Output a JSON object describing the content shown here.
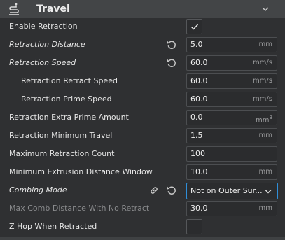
{
  "section": {
    "title": "Travel",
    "icon": "travel-icon",
    "collapse_icon": "chevron-down-icon"
  },
  "settings": [
    {
      "label": "Enable Retraction",
      "type": "checkbox",
      "checked": true
    },
    {
      "label": "Retraction Distance",
      "type": "number",
      "value": "5.0",
      "unit": "mm",
      "modified": true
    },
    {
      "label": "Retraction Speed",
      "type": "number",
      "value": "60.0",
      "unit": "mm/s",
      "modified": true
    },
    {
      "label": "Retraction Retract Speed",
      "type": "number",
      "value": "60.0",
      "unit": "mm/s",
      "indent": true
    },
    {
      "label": "Retraction Prime Speed",
      "type": "number",
      "value": "60.0",
      "unit": "mm/s",
      "indent": true
    },
    {
      "label": "Retraction Extra Prime Amount",
      "type": "number",
      "value": "0.0",
      "unit": "mm",
      "unit_sup": "3"
    },
    {
      "label": "Retraction Minimum Travel",
      "type": "number",
      "value": "1.5",
      "unit": "mm"
    },
    {
      "label": "Maximum Retraction Count",
      "type": "number",
      "value": "100",
      "unit": ""
    },
    {
      "label": "Minimum Extrusion Distance Window",
      "type": "number",
      "value": "10.0",
      "unit": "mm"
    },
    {
      "label": "Combing Mode",
      "type": "select",
      "value": "Not on Outer Sur...",
      "modified": true,
      "linked": true
    },
    {
      "label": "Max Comb Distance With No Retract",
      "type": "number",
      "value": "30.0",
      "unit": "mm",
      "disabled": true
    },
    {
      "label": "Z Hop When Retracted",
      "type": "checkbox",
      "checked": false
    }
  ],
  "colors": {
    "accent": "#2f8ed8",
    "background": "#2f3032",
    "header": "#434547"
  }
}
